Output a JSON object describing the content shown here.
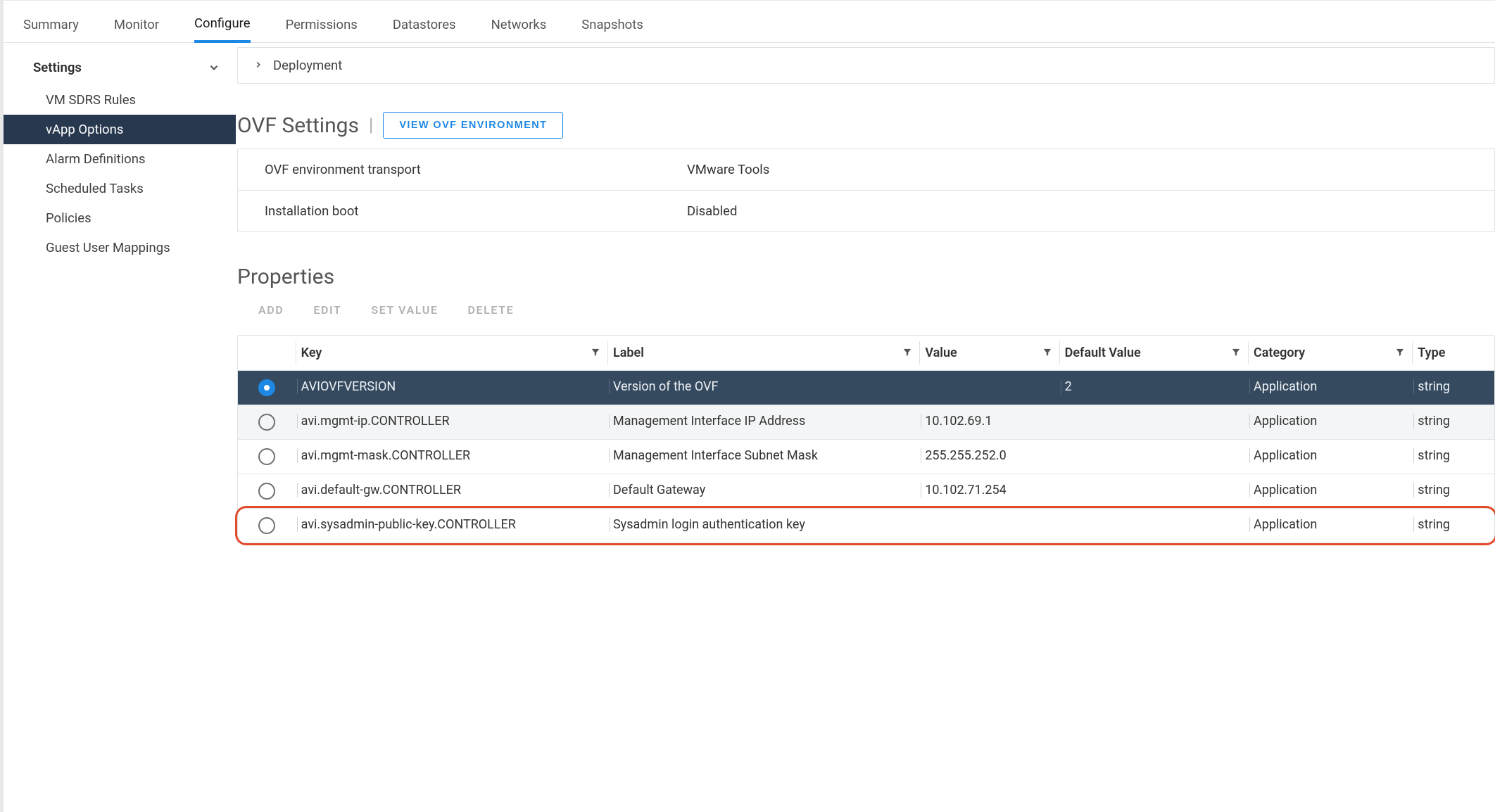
{
  "tabs": [
    "Summary",
    "Monitor",
    "Configure",
    "Permissions",
    "Datastores",
    "Networks",
    "Snapshots"
  ],
  "activeTab": "Configure",
  "sidebar": {
    "heading": "Settings",
    "items": [
      "VM SDRS Rules",
      "vApp Options",
      "Alarm Definitions",
      "Scheduled Tasks",
      "Policies",
      "Guest User Mappings"
    ],
    "active": "vApp Options"
  },
  "deployment": {
    "label": "Deployment"
  },
  "ovf": {
    "title": "OVF Settings",
    "button": "VIEW OVF ENVIRONMENT",
    "rows": [
      {
        "k": "OVF environment transport",
        "v": "VMware Tools"
      },
      {
        "k": "Installation boot",
        "v": "Disabled"
      }
    ]
  },
  "props": {
    "title": "Properties",
    "actions": [
      "ADD",
      "EDIT",
      "SET VALUE",
      "DELETE"
    ],
    "cols": [
      "Key",
      "Label",
      "Value",
      "Default Value",
      "Category",
      "Type"
    ],
    "rows": [
      {
        "selected": true,
        "key": "AVIOVFVERSION",
        "label": "Version of the OVF",
        "value": "",
        "default": "2",
        "category": "Application",
        "type": "string"
      },
      {
        "selected": false,
        "key": "avi.mgmt-ip.CONTROLLER",
        "label": "Management Interface IP Address",
        "value": "10.102.69.1",
        "default": "",
        "category": "Application",
        "type": "string"
      },
      {
        "selected": false,
        "key": "avi.mgmt-mask.CONTROLLER",
        "label": "Management Interface Subnet Mask",
        "value": "255.255.252.0",
        "default": "",
        "category": "Application",
        "type": "string"
      },
      {
        "selected": false,
        "key": "avi.default-gw.CONTROLLER",
        "label": "Default Gateway",
        "value": "10.102.71.254",
        "default": "",
        "category": "Application",
        "type": "string"
      },
      {
        "selected": false,
        "key": "avi.sysadmin-public-key.CONTROLLER",
        "label": "Sysadmin login authentication key",
        "value": "",
        "default": "",
        "category": "Application",
        "type": "string",
        "highlight": true
      }
    ]
  }
}
